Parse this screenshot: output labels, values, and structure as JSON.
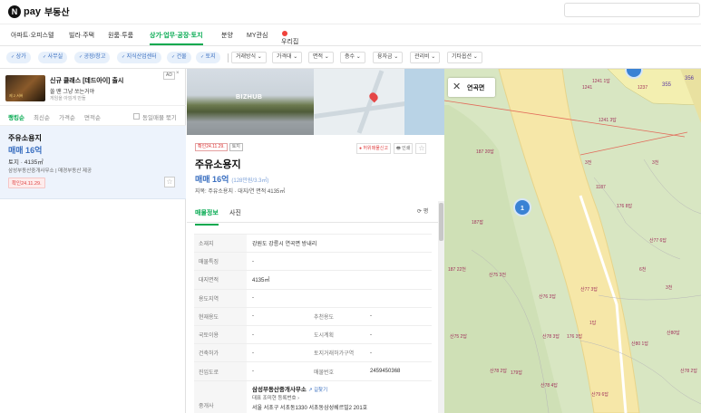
{
  "header": {
    "logo_mark": "N",
    "logo_pay": "pay",
    "logo_text": "부동산"
  },
  "nav": {
    "items": [
      "아파트·오피스텔",
      "빌라·주택",
      "원룸·투룸",
      "상가·업무·공장·토지",
      "분양",
      "MY관심",
      "우리집"
    ],
    "active_index": 3,
    "new_dot_color": "#f0433c"
  },
  "filters": {
    "chips": [
      "상가",
      "사무실",
      "공장/창고",
      "지식산업센터",
      "건물",
      "토지"
    ],
    "dropdowns": [
      "거래방식",
      "가격대",
      "면적",
      "층수",
      "융자금",
      "관리비",
      "기타옵션"
    ]
  },
  "ad": {
    "thumb_caption": "제 2 서버",
    "title": "신규 클래스 [데드아이] 출시",
    "line2": "쏠 땐 그냥 쏘는거야",
    "line3": "게임을 아낌게 만들",
    "tag": "AD",
    "close": "×"
  },
  "sort": {
    "options": [
      "랭킹순",
      "최신순",
      "가격순",
      "면적순"
    ],
    "active_index": 0,
    "same_listing_label": "동일매물 묶기"
  },
  "listing": {
    "title": "주유소용지",
    "price": "매매 16억",
    "info": "토지 · 4135㎡",
    "agent": "삼성부동산중개사무소 | 매경부동산 제공",
    "badge": "확인24.11.29.",
    "star": "☆"
  },
  "detail": {
    "photo_watermark": "BIZHUB",
    "pill_confirm": "확인24.11.29.",
    "pill_type": "토지",
    "btn_report": "● 허위매물신고",
    "btn_print": "🖶 인쇄",
    "btn_star": "☆",
    "title": "주유소용지",
    "price": "매매 16억",
    "price_per": "(128만원/3.3㎡)",
    "sub": "지목: 주유소용지 · 대지/연 면적 4135㎡",
    "tabs": [
      "매물정보",
      "사진"
    ],
    "active_tab": 0,
    "tab_right": "⟳ 평",
    "rows": [
      {
        "k": "소재지",
        "v": "강원도 강릉시 연곡면 방내리"
      },
      {
        "k": "매물특징",
        "v": "-"
      },
      {
        "k": "대지면적",
        "v": "4135㎡"
      },
      {
        "k": "용도지역",
        "v": "-"
      },
      {
        "k": "현재용도",
        "v": "-",
        "k2": "추천용도",
        "v2": "-"
      },
      {
        "k": "국토이용",
        "v": "-",
        "k2": "도시계획",
        "v2": "-"
      },
      {
        "k": "건축허가",
        "v": "-",
        "k2": "토지거래허가구역",
        "v2": "-"
      },
      {
        "k": "진입도로",
        "v": "-",
        "k2": "매물번호",
        "v2": "2459450368"
      }
    ],
    "agent_label": "중개사",
    "agent_name": "삼성부동산중개사무소",
    "agent_link": "↗ 길찾기",
    "agent_rep": "대표 조미현 등록번호 ›",
    "agent_addr": "서울 서초구 서초동1330 서초동삼성쉐르빌2 201호"
  },
  "map": {
    "close": "✕",
    "place": "연곡면",
    "cluster_count": "1",
    "cluster_top": "",
    "labels": [
      "1241 1답",
      "1241 3답",
      "1241",
      "355",
      "356",
      "1237",
      "3천",
      "187 20답",
      "3전",
      "1187",
      "187잡",
      "176 8답",
      "187 22천",
      "산75 3전",
      "산76 3답",
      "산77 3답",
      "산77 6답",
      "6천",
      "3천",
      "1답",
      "산75 2답",
      "산78 3답",
      "176 3답",
      "산80 1답",
      "산80답",
      "산78 2답",
      "179답",
      "산78 4답",
      "산79 6답",
      "산78 2답"
    ]
  }
}
